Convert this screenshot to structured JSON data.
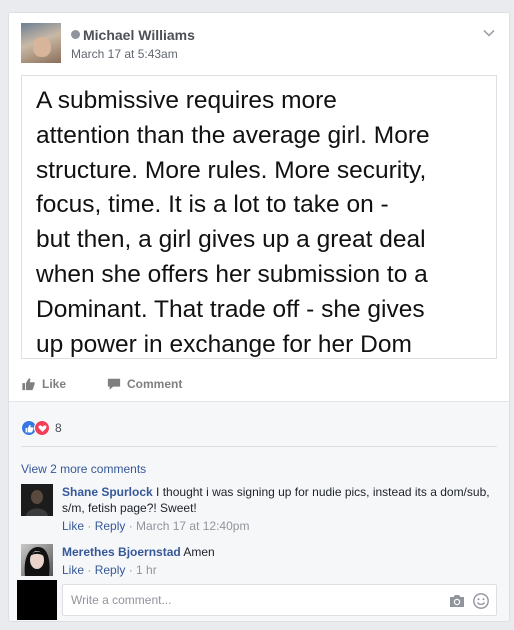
{
  "post": {
    "author": "Michael Williams",
    "timestamp": "March 17 at 5:43am",
    "image_text_lines": [
      "A submissive requires more",
      "attention than the average girl. More",
      "structure. More rules. More security,",
      "focus, time. It is a lot to take on -",
      "but then, a girl gives up a great deal",
      "when she offers her submission to a",
      "Dominant. That trade off - she gives",
      "up power in exchange for her Dom"
    ]
  },
  "actions": {
    "like_label": "Like",
    "comment_label": "Comment"
  },
  "reactions": {
    "count": "8"
  },
  "comments": {
    "view_more_label": "View 2 more comments",
    "items": [
      {
        "author": "Shane Spurlock",
        "text": "I thought i was signing up for nudie pics, instead its a dom/sub, s/m, fetish page?! Sweet!",
        "like": "Like",
        "reply": "Reply",
        "time": "March 17 at 12:40pm"
      },
      {
        "author": "Merethes Bjoernstad",
        "text": "Amen",
        "like": "Like",
        "reply": "Reply",
        "time": "1 hr"
      }
    ]
  },
  "composer": {
    "placeholder": "Write a comment..."
  },
  "icons": {
    "verified": "verified-badge-icon",
    "chevron": "chevron-down-icon",
    "like": "thumbs-up-icon",
    "comment": "speech-bubble-icon",
    "camera": "camera-icon",
    "emoji": "smiley-icon"
  },
  "colors": {
    "link": "#365899",
    "like_reaction": "#3578e5",
    "love_reaction": "#f33e58"
  }
}
